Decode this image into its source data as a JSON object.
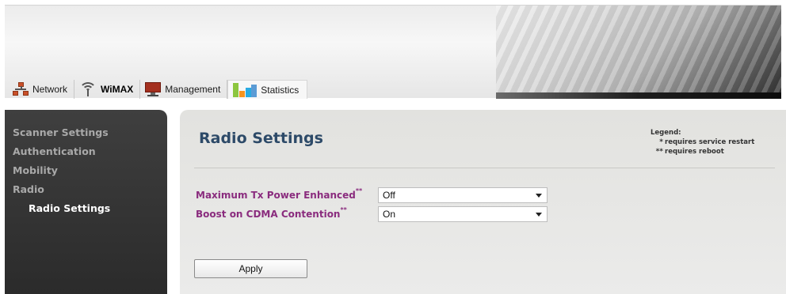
{
  "tabs": [
    {
      "label": "Network",
      "icon": "network-icon",
      "active": false
    },
    {
      "label": "WiMAX",
      "icon": "wifi-icon",
      "active": true
    },
    {
      "label": "Management",
      "icon": "monitor-icon",
      "active": false
    },
    {
      "label": "Statistics",
      "icon": "bar-chart-icon",
      "active": false
    }
  ],
  "sidebar": {
    "items": [
      {
        "label": "Scanner Settings"
      },
      {
        "label": "Authentication"
      },
      {
        "label": "Mobility"
      },
      {
        "label": "Radio"
      },
      {
        "label": "Radio Settings",
        "selected": true
      }
    ]
  },
  "main": {
    "title": "Radio Settings",
    "legend": {
      "title": "Legend:",
      "items": [
        {
          "mark": "*",
          "text": "requires service restart"
        },
        {
          "mark": "**",
          "text": "requires reboot"
        }
      ]
    },
    "fields": [
      {
        "label": "Maximum Tx Power Enhanced",
        "mark": "**",
        "value": "Off"
      },
      {
        "label": "Boost on CDMA Contention",
        "mark": "**",
        "value": "On"
      }
    ],
    "apply_label": "Apply"
  },
  "colors": {
    "title": "#2d4a68",
    "field_label": "#8a2c7e",
    "sidebar_bg": "#333333",
    "sidebar_text": "#a9a9a9",
    "panel_bg": "#e6e6e4"
  }
}
